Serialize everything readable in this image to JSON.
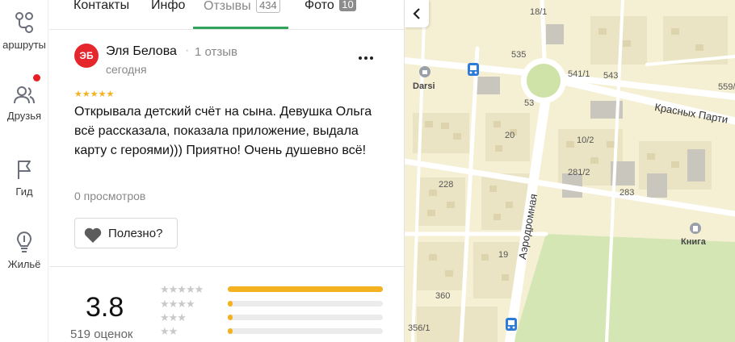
{
  "rail": {
    "items": [
      {
        "label": "аршруты",
        "icon": "routes-icon"
      },
      {
        "label": "Друзья",
        "icon": "friends-icon"
      },
      {
        "label": "Гид",
        "icon": "flag-icon"
      },
      {
        "label": "Жильё",
        "icon": "housing-icon"
      }
    ]
  },
  "tabs": [
    {
      "label": "Контакты",
      "count": ""
    },
    {
      "label": "Инфо",
      "count": ""
    },
    {
      "label": "Отзывы",
      "count": "434"
    },
    {
      "label": "Фото",
      "count": "10"
    }
  ],
  "review": {
    "avatar_initials": "ЭБ",
    "author": "Эля Белова",
    "author_reviews": "1 отзыв",
    "date": "сегодня",
    "stars": "★★★★★",
    "rating": 5,
    "text": "Открывала детский счёт на сына. Девушка Ольга всё рассказала, показала приложение, выдала карту с героями))) Приятно! Очень душевно всё!",
    "views": "0 просмотров",
    "useful_label": "Полезно?"
  },
  "summary": {
    "rating": "3.8",
    "count": "519 оценок",
    "distribution": [
      {
        "stars": "★★★★★",
        "fraction": 1.0
      },
      {
        "stars": "★★★★",
        "fraction": 0.03
      },
      {
        "stars": "★★★",
        "fraction": 0.03
      },
      {
        "stars": "★★",
        "fraction": 0.03
      }
    ]
  },
  "map": {
    "labels": {
      "l18_1": "18/1",
      "l535": "535",
      "l541_1": "541/1",
      "l543": "543",
      "l559": "559/",
      "l53": "53",
      "l20": "20",
      "l10_2": "10/2",
      "l281_2": "281/2",
      "l228": "228",
      "l283": "283",
      "l19": "19",
      "l360": "360",
      "l356_1": "356/1"
    },
    "streets": {
      "krasnykh": "Красных Парти",
      "aerodromnaya": "Аэродромная"
    },
    "pois": {
      "darsi": "Darsi",
      "kniga": "Книга"
    }
  }
}
